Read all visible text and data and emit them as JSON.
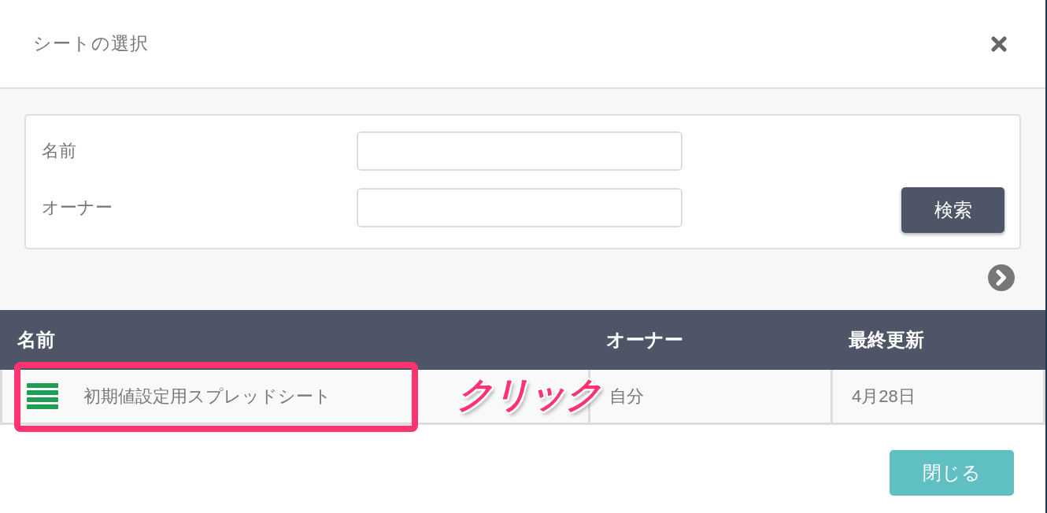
{
  "dialog": {
    "title": "シートの選択"
  },
  "search": {
    "fields": [
      {
        "label": "名前"
      },
      {
        "label": "オーナー"
      }
    ],
    "button": "検索"
  },
  "table": {
    "columns": [
      "名前",
      "オーナー",
      "最終更新"
    ],
    "rows": [
      {
        "cells": [
          "初期値設定用スプレッドシート",
          "自分",
          "4月28日"
        ],
        "highlighted": true
      }
    ]
  },
  "annotation": {
    "text": "クリック"
  },
  "footer": {
    "buttons": [
      "閉じる"
    ]
  }
}
